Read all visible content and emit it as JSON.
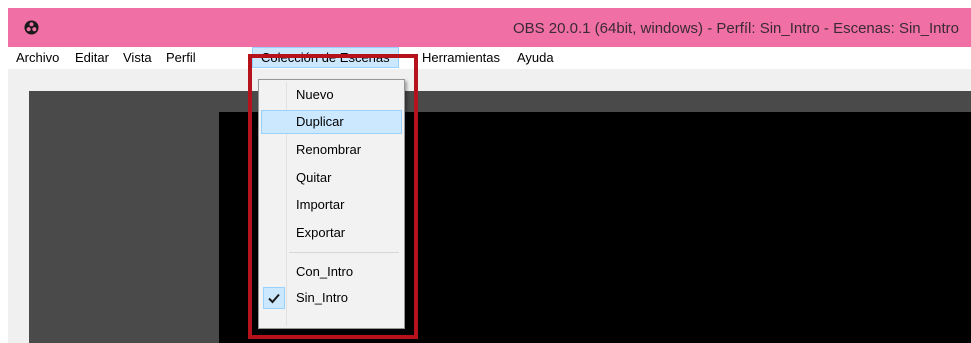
{
  "window": {
    "title": "OBS 20.0.1 (64bit, windows) - Perfíl: Sin_Intro - Escenas: Sin_Intro",
    "titlebar_color": "#f070a6",
    "app_icon": "obs-logo-icon"
  },
  "menubar": {
    "items": [
      {
        "label": "Archivo"
      },
      {
        "label": "Editar"
      },
      {
        "label": "Vista"
      },
      {
        "label": "Perfil"
      },
      {
        "label": "Colección de Escenas"
      },
      {
        "label": "Herramientas"
      },
      {
        "label": "Ayuda"
      }
    ],
    "active_item": "Colección de Escenas"
  },
  "dropdown": {
    "items": [
      {
        "label": "Nuevo"
      },
      {
        "label": "Duplicar"
      },
      {
        "label": "Renombrar"
      },
      {
        "label": "Quitar"
      },
      {
        "label": "Importar"
      },
      {
        "label": "Exportar"
      }
    ],
    "collections": [
      {
        "label": "Con_Intro",
        "checked": false
      },
      {
        "label": "Sin_Intro",
        "checked": true
      }
    ],
    "hovered_item": "Duplicar",
    "check_icon": "checkmark-icon"
  },
  "annotation": {
    "highlight_color": "#b5121b"
  }
}
